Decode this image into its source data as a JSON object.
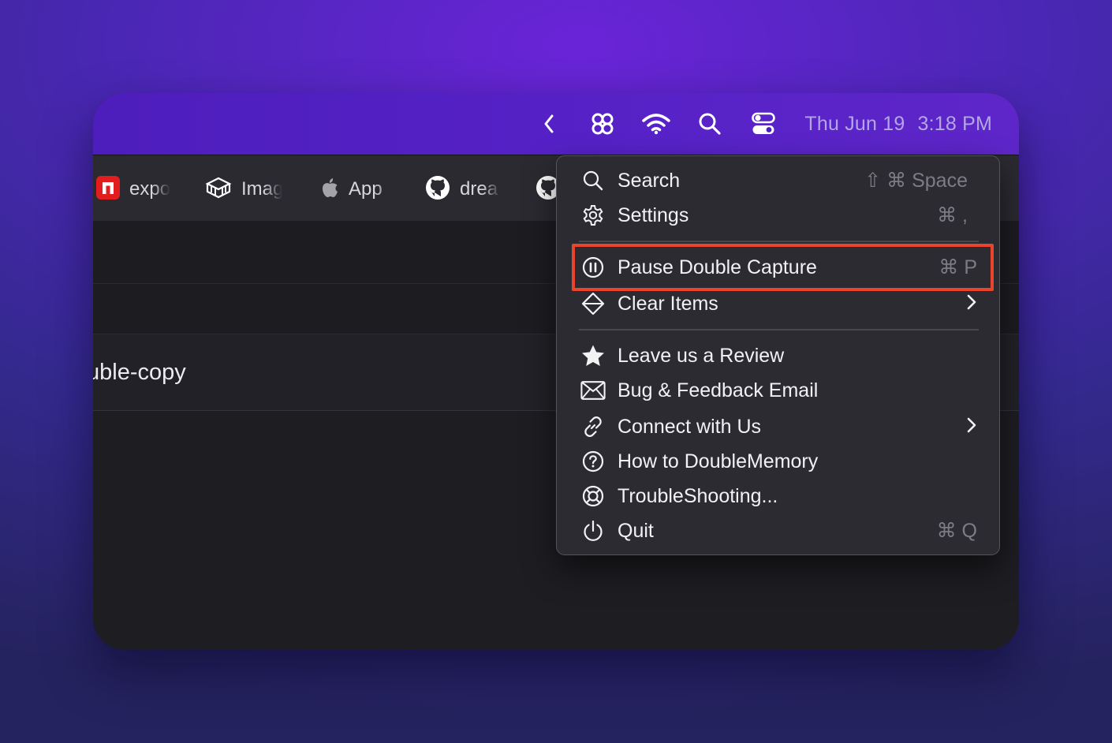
{
  "menubar": {
    "icons": [
      "chevron-left-icon",
      "double-app-icon",
      "wifi-icon",
      "search-icon",
      "control-center-icon"
    ],
    "date": "Thu Jun 19",
    "time": "3:18 PM"
  },
  "tabs": [
    {
      "label": "expo",
      "icon": "expo-app-icon"
    },
    {
      "label": "Imag",
      "icon": "imag-app-icon"
    },
    {
      "label": "App",
      "icon": "apple-icon"
    },
    {
      "label": "drea",
      "icon": "github-icon"
    }
  ],
  "content": {
    "row_text": "uble-copy"
  },
  "menu": {
    "search": {
      "label": "Search",
      "shortcut": "⇧ ⌘ Space"
    },
    "settings": {
      "label": "Settings",
      "shortcut": "⌘ ,"
    },
    "pause": {
      "label": "Pause Double Capture",
      "shortcut": "⌘ P"
    },
    "clear": {
      "label": "Clear Items"
    },
    "review": {
      "label": "Leave us a Review"
    },
    "feedback": {
      "label": "Bug & Feedback Email"
    },
    "connect": {
      "label": "Connect with Us"
    },
    "howto": {
      "label": "How to DoubleMemory"
    },
    "troubleshoot": {
      "label": "TroubleShooting..."
    },
    "quit": {
      "label": "Quit",
      "shortcut": "⌘ Q"
    }
  },
  "highlight_color": "#e8452c"
}
